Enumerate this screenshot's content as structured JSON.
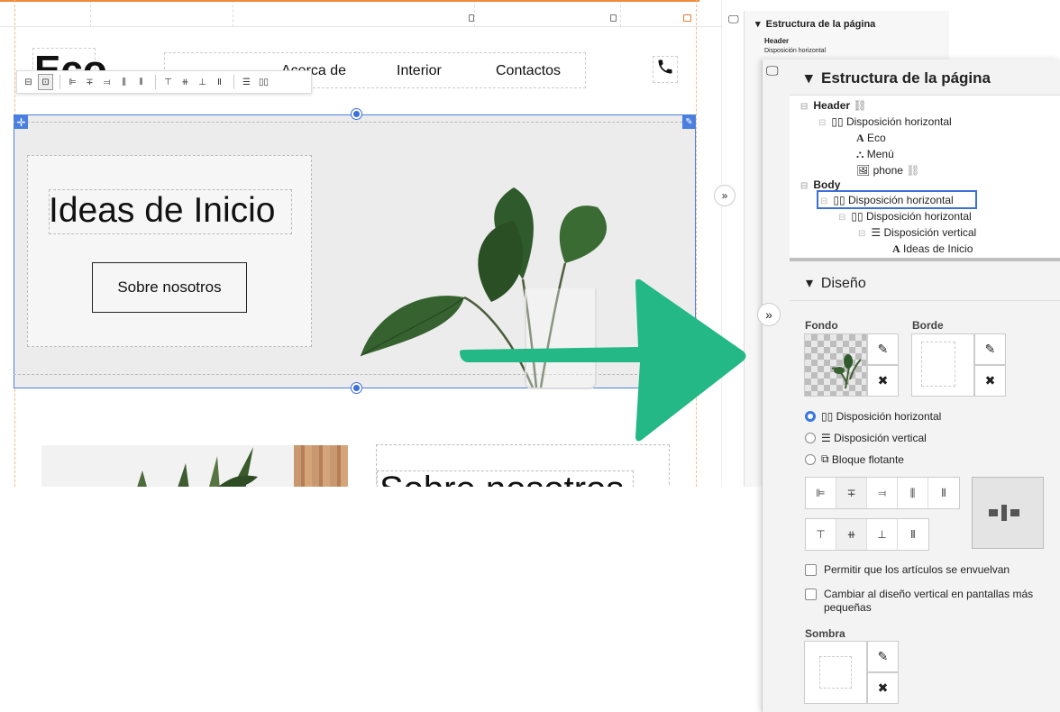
{
  "editor": {
    "logo_text": "Eco",
    "menu": [
      "Acerca de",
      "Interior",
      "Contactos"
    ],
    "hero_title": "Ideas de Inicio",
    "hero_button": "Sobre nosotros",
    "section2_heading": "Sobre nosotros"
  },
  "back_panel": {
    "title": "Estructura de la página",
    "header": "Header",
    "item": "Disposición horizontal"
  },
  "panel": {
    "structure_title": "Estructura de la página",
    "tree": [
      {
        "label": "Header",
        "icon": "link-icon"
      },
      {
        "label": "Disposición horizontal",
        "icon": "horizontal-layout-icon"
      },
      {
        "label": "Eco",
        "icon": "text-icon"
      },
      {
        "label": "Menú",
        "icon": "menu-tree-icon"
      },
      {
        "label": "phone",
        "icon": "image-icon"
      },
      {
        "label": "Body",
        "icon": ""
      },
      {
        "label": "Disposición horizontal",
        "icon": "horizontal-layout-icon"
      },
      {
        "label": "Disposición horizontal",
        "icon": "horizontal-layout-icon"
      },
      {
        "label": "Disposición vertical",
        "icon": "vertical-layout-icon"
      },
      {
        "label": "Ideas de Inicio",
        "icon": "text-icon"
      }
    ],
    "design_title": "Diseño",
    "fondo_label": "Fondo",
    "borde_label": "Borde",
    "layout_options": [
      "Disposición horizontal",
      "Disposición vertical",
      "Bloque flotante"
    ],
    "layout_selected": "Disposición horizontal",
    "checkbox_wrap": "Permitir que los artículos se envuelvan",
    "checkbox_vertical": "Cambiar al diseño vertical en pantallas más pequeñas",
    "sombra_label": "Sombra"
  },
  "colors": {
    "selection_blue": "#4a7fe0",
    "arrow_green": "#23b886",
    "ruler_orange": "#f08a3a"
  }
}
